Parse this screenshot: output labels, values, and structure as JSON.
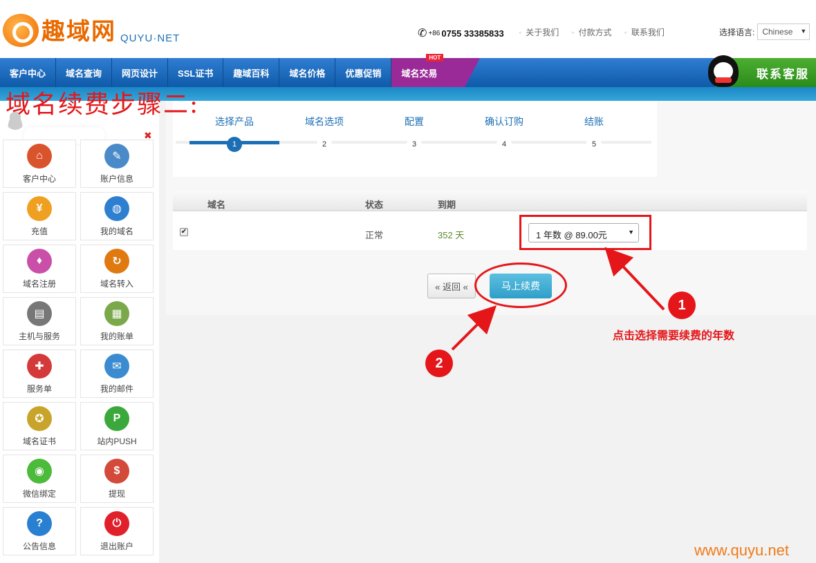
{
  "header": {
    "logo_cn": "趣域网",
    "logo_en": "QUYU·NET",
    "phone_prefix": "+86",
    "phone": "0755 33385833",
    "links": [
      "关于我们",
      "付款方式",
      "联系我们"
    ],
    "lang_label": "选择语言:",
    "lang_value": "Chinese"
  },
  "nav": {
    "items": [
      "客户中心",
      "域名查询",
      "网页设计",
      "SSL证书",
      "趣域百科",
      "域名价格",
      "优惠促销",
      "域名交易"
    ],
    "hot": "HOT",
    "contact": "联系客服"
  },
  "overlay_title": "域名续费步骤二:",
  "sidebar": {
    "tiles": [
      {
        "label": "客户中心",
        "icon": "home-icon",
        "color": "#d9532c",
        "glyph": "⌂"
      },
      {
        "label": "账户信息",
        "icon": "user-edit-icon",
        "color": "#4a8ac9",
        "glyph": "✎"
      },
      {
        "label": "充值",
        "icon": "coins-icon",
        "color": "#f0a020",
        "glyph": "¥"
      },
      {
        "label": "我的域名",
        "icon": "globe-icon",
        "color": "#2f7fd0",
        "glyph": "◍"
      },
      {
        "label": "域名注册",
        "icon": "cart-icon",
        "color": "#c94fa8",
        "glyph": "♦"
      },
      {
        "label": "域名转入",
        "icon": "transfer-icon",
        "color": "#e07a10",
        "glyph": "↻"
      },
      {
        "label": "主机与服务",
        "icon": "server-icon",
        "color": "#777777",
        "glyph": "▤"
      },
      {
        "label": "我的账单",
        "icon": "bill-icon",
        "color": "#7aa84a",
        "glyph": "▦"
      },
      {
        "label": "服务单",
        "icon": "ticket-icon",
        "color": "#d43a3a",
        "glyph": "✚"
      },
      {
        "label": "我的邮件",
        "icon": "mail-icon",
        "color": "#3a8bcf",
        "glyph": "✉"
      },
      {
        "label": "域名证书",
        "icon": "certificate-icon",
        "color": "#c9a42a",
        "glyph": "✪"
      },
      {
        "label": "站内PUSH",
        "icon": "push-icon",
        "color": "#3aa83a",
        "glyph": "P"
      },
      {
        "label": "微信绑定",
        "icon": "wechat-icon",
        "color": "#4cba3a",
        "glyph": "◉"
      },
      {
        "label": "提现",
        "icon": "cash-icon",
        "color": "#d34a3a",
        "glyph": "$"
      },
      {
        "label": "公告信息",
        "icon": "help-icon",
        "color": "#2a80d0",
        "glyph": "?"
      },
      {
        "label": "退出账户",
        "icon": "power-icon",
        "color": "#e0202a",
        "glyph": "⏻"
      }
    ]
  },
  "steps": [
    {
      "label": "选择产品",
      "num": "1"
    },
    {
      "label": "域名选项",
      "num": "2"
    },
    {
      "label": "配置",
      "num": "3"
    },
    {
      "label": "确认订购",
      "num": "4"
    },
    {
      "label": "结账",
      "num": "5"
    }
  ],
  "table": {
    "headers": {
      "domain": "域名",
      "status": "状态",
      "expiry": "到期"
    },
    "row": {
      "checked": "✔",
      "status": "正常",
      "expiry": "352 天",
      "period": "1 年数 @ 89.00元"
    }
  },
  "buttons": {
    "back": "« 返回 «",
    "renew": "马上续费"
  },
  "annotations": {
    "one": "1",
    "two": "2",
    "instruction": "点击选择需要续费的年数"
  },
  "watermark": "www.quyu.net"
}
